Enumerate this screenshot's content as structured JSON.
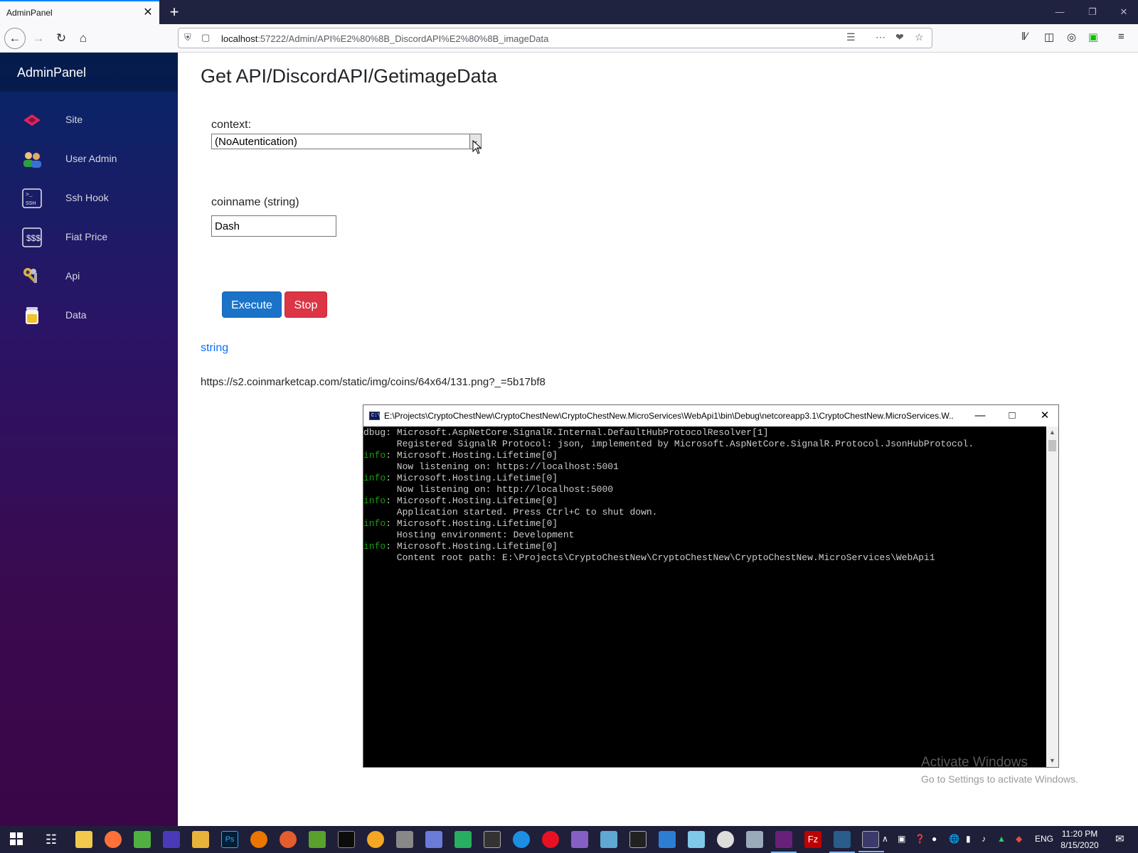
{
  "browser": {
    "tab_title": "AdminPanel",
    "tab_close": "✕",
    "new_tab": "+",
    "url_host": "localhost",
    "url_rest": ":57222/Admin/API%E2%80%8B_DiscordAPI%E2%80%8B_imageData"
  },
  "sidebar": {
    "brand": "AdminPanel",
    "items": [
      {
        "label": "Site",
        "icon": "site-icon"
      },
      {
        "label": "User Admin",
        "icon": "users-icon"
      },
      {
        "label": "Ssh Hook",
        "icon": "ssh-terminal-icon"
      },
      {
        "label": "Fiat Price",
        "icon": "fiat-price-icon"
      },
      {
        "label": "Api",
        "icon": "keys-icon"
      },
      {
        "label": "Data",
        "icon": "data-jar-icon"
      }
    ]
  },
  "main": {
    "title": "Get API/DiscordAPI/GetimageData",
    "context_label": "context:",
    "context_value": "(NoAutentication)",
    "coinname_label": "coinname (string)",
    "coinname_value": "Dash",
    "execute_label": "Execute",
    "stop_label": "Stop",
    "result_type": "string",
    "result_value": "https://s2.coinmarketcap.com/static/img/coins/64x64/131.png?_=5b17bf8"
  },
  "console": {
    "icon_text": "C:\\",
    "title": "E:\\Projects\\CryptoChestNew\\CryptoChestNew\\CryptoChestNew.MicroServices\\WebApi1\\bin\\Debug\\netcoreapp3.1\\CryptoChestNew.MicroServices.W...",
    "lines": [
      {
        "level": "dbug",
        "text": ": Microsoft.AspNetCore.SignalR.Internal.DefaultHubProtocolResolver[1]"
      },
      {
        "level": "",
        "text": "      Registered SignalR Protocol: json, implemented by Microsoft.AspNetCore.SignalR.Protocol.JsonHubProtocol."
      },
      {
        "level": "info",
        "text": ": Microsoft.Hosting.Lifetime[0]"
      },
      {
        "level": "",
        "text": "      Now listening on: https://localhost:5001"
      },
      {
        "level": "info",
        "text": ": Microsoft.Hosting.Lifetime[0]"
      },
      {
        "level": "",
        "text": "      Now listening on: http://localhost:5000"
      },
      {
        "level": "info",
        "text": ": Microsoft.Hosting.Lifetime[0]"
      },
      {
        "level": "",
        "text": "      Application started. Press Ctrl+C to shut down."
      },
      {
        "level": "info",
        "text": ": Microsoft.Hosting.Lifetime[0]"
      },
      {
        "level": "",
        "text": "      Hosting environment: Development"
      },
      {
        "level": "info",
        "text": ": Microsoft.Hosting.Lifetime[0]"
      },
      {
        "level": "",
        "text": "      Content root path: E:\\Projects\\CryptoChestNew\\CryptoChestNew\\CryptoChestNew.MicroServices\\WebApi1"
      }
    ]
  },
  "watermark": {
    "line1": "Activate Windows",
    "line2": "Go to Settings to activate Windows."
  },
  "taskbar": {
    "language": "ENG",
    "time": "11:20 PM",
    "date": "8/15/2020"
  },
  "colors": {
    "accent_blue": "#1a73c8",
    "stop_red": "#dc3545",
    "link_blue": "#0d6efd",
    "console_info": "#13a10e"
  }
}
